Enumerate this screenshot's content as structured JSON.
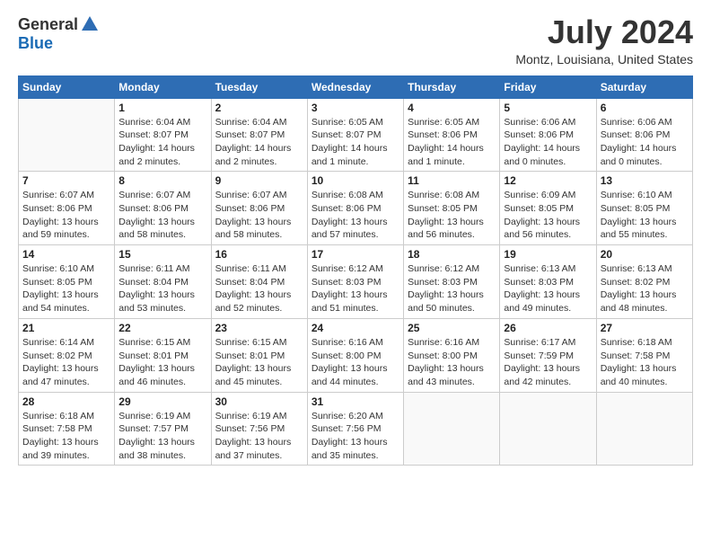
{
  "header": {
    "logo_general": "General",
    "logo_blue": "Blue",
    "title": "July 2024",
    "subtitle": "Montz, Louisiana, United States"
  },
  "weekdays": [
    "Sunday",
    "Monday",
    "Tuesday",
    "Wednesday",
    "Thursday",
    "Friday",
    "Saturday"
  ],
  "weeks": [
    [
      {
        "day": "",
        "info": ""
      },
      {
        "day": "1",
        "info": "Sunrise: 6:04 AM\nSunset: 8:07 PM\nDaylight: 14 hours\nand 2 minutes."
      },
      {
        "day": "2",
        "info": "Sunrise: 6:04 AM\nSunset: 8:07 PM\nDaylight: 14 hours\nand 2 minutes."
      },
      {
        "day": "3",
        "info": "Sunrise: 6:05 AM\nSunset: 8:07 PM\nDaylight: 14 hours\nand 1 minute."
      },
      {
        "day": "4",
        "info": "Sunrise: 6:05 AM\nSunset: 8:06 PM\nDaylight: 14 hours\nand 1 minute."
      },
      {
        "day": "5",
        "info": "Sunrise: 6:06 AM\nSunset: 8:06 PM\nDaylight: 14 hours\nand 0 minutes."
      },
      {
        "day": "6",
        "info": "Sunrise: 6:06 AM\nSunset: 8:06 PM\nDaylight: 14 hours\nand 0 minutes."
      }
    ],
    [
      {
        "day": "7",
        "info": "Sunrise: 6:07 AM\nSunset: 8:06 PM\nDaylight: 13 hours\nand 59 minutes."
      },
      {
        "day": "8",
        "info": "Sunrise: 6:07 AM\nSunset: 8:06 PM\nDaylight: 13 hours\nand 58 minutes."
      },
      {
        "day": "9",
        "info": "Sunrise: 6:07 AM\nSunset: 8:06 PM\nDaylight: 13 hours\nand 58 minutes."
      },
      {
        "day": "10",
        "info": "Sunrise: 6:08 AM\nSunset: 8:06 PM\nDaylight: 13 hours\nand 57 minutes."
      },
      {
        "day": "11",
        "info": "Sunrise: 6:08 AM\nSunset: 8:05 PM\nDaylight: 13 hours\nand 56 minutes."
      },
      {
        "day": "12",
        "info": "Sunrise: 6:09 AM\nSunset: 8:05 PM\nDaylight: 13 hours\nand 56 minutes."
      },
      {
        "day": "13",
        "info": "Sunrise: 6:10 AM\nSunset: 8:05 PM\nDaylight: 13 hours\nand 55 minutes."
      }
    ],
    [
      {
        "day": "14",
        "info": "Sunrise: 6:10 AM\nSunset: 8:05 PM\nDaylight: 13 hours\nand 54 minutes."
      },
      {
        "day": "15",
        "info": "Sunrise: 6:11 AM\nSunset: 8:04 PM\nDaylight: 13 hours\nand 53 minutes."
      },
      {
        "day": "16",
        "info": "Sunrise: 6:11 AM\nSunset: 8:04 PM\nDaylight: 13 hours\nand 52 minutes."
      },
      {
        "day": "17",
        "info": "Sunrise: 6:12 AM\nSunset: 8:03 PM\nDaylight: 13 hours\nand 51 minutes."
      },
      {
        "day": "18",
        "info": "Sunrise: 6:12 AM\nSunset: 8:03 PM\nDaylight: 13 hours\nand 50 minutes."
      },
      {
        "day": "19",
        "info": "Sunrise: 6:13 AM\nSunset: 8:03 PM\nDaylight: 13 hours\nand 49 minutes."
      },
      {
        "day": "20",
        "info": "Sunrise: 6:13 AM\nSunset: 8:02 PM\nDaylight: 13 hours\nand 48 minutes."
      }
    ],
    [
      {
        "day": "21",
        "info": "Sunrise: 6:14 AM\nSunset: 8:02 PM\nDaylight: 13 hours\nand 47 minutes."
      },
      {
        "day": "22",
        "info": "Sunrise: 6:15 AM\nSunset: 8:01 PM\nDaylight: 13 hours\nand 46 minutes."
      },
      {
        "day": "23",
        "info": "Sunrise: 6:15 AM\nSunset: 8:01 PM\nDaylight: 13 hours\nand 45 minutes."
      },
      {
        "day": "24",
        "info": "Sunrise: 6:16 AM\nSunset: 8:00 PM\nDaylight: 13 hours\nand 44 minutes."
      },
      {
        "day": "25",
        "info": "Sunrise: 6:16 AM\nSunset: 8:00 PM\nDaylight: 13 hours\nand 43 minutes."
      },
      {
        "day": "26",
        "info": "Sunrise: 6:17 AM\nSunset: 7:59 PM\nDaylight: 13 hours\nand 42 minutes."
      },
      {
        "day": "27",
        "info": "Sunrise: 6:18 AM\nSunset: 7:58 PM\nDaylight: 13 hours\nand 40 minutes."
      }
    ],
    [
      {
        "day": "28",
        "info": "Sunrise: 6:18 AM\nSunset: 7:58 PM\nDaylight: 13 hours\nand 39 minutes."
      },
      {
        "day": "29",
        "info": "Sunrise: 6:19 AM\nSunset: 7:57 PM\nDaylight: 13 hours\nand 38 minutes."
      },
      {
        "day": "30",
        "info": "Sunrise: 6:19 AM\nSunset: 7:56 PM\nDaylight: 13 hours\nand 37 minutes."
      },
      {
        "day": "31",
        "info": "Sunrise: 6:20 AM\nSunset: 7:56 PM\nDaylight: 13 hours\nand 35 minutes."
      },
      {
        "day": "",
        "info": ""
      },
      {
        "day": "",
        "info": ""
      },
      {
        "day": "",
        "info": ""
      }
    ]
  ]
}
